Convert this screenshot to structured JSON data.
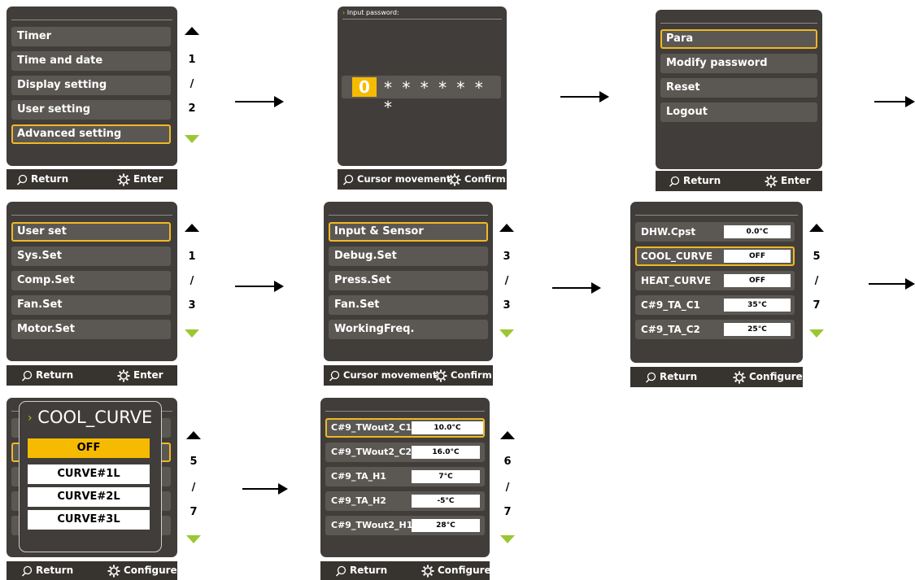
{
  "colors": {
    "screen_bg": "#403d3a",
    "item_bg": "#5b5854",
    "selected_border": "#f1b824",
    "selected_fill": "#f6bb00",
    "scroll_down": "#9bc733"
  },
  "s1": {
    "items": [
      "Timer",
      "Time and date",
      "Display setting",
      "User setting",
      "Advanced setting"
    ],
    "page": "1",
    "sep": "/",
    "total": "2",
    "footer_left": "Return",
    "footer_right": "Enter"
  },
  "s2": {
    "title": "Input password:",
    "digit": "0",
    "stars": "* * * * * * *",
    "footer_left": "Cursor movement",
    "footer_right": "Confirm"
  },
  "s3": {
    "items": [
      "Para",
      "Modify password",
      "Reset",
      "Logout"
    ],
    "footer_left": "Return",
    "footer_right": "Enter"
  },
  "s4": {
    "items": [
      "User set",
      "Sys.Set",
      "Comp.Set",
      "Fan.Set",
      "Motor.Set"
    ],
    "page": "1",
    "sep": "/",
    "total": "3",
    "footer_left": "Return",
    "footer_right": "Enter"
  },
  "s5": {
    "items": [
      "Input & Sensor",
      "Debug.Set",
      "Press.Set",
      "Fan.Set",
      "WorkingFreq."
    ],
    "page": "3",
    "sep": "/",
    "total": "3",
    "footer_left": "Cursor movement",
    "footer_right": "Confirm"
  },
  "s6": {
    "items": [
      {
        "label": "DHW.Cpst",
        "value": "0.0°C"
      },
      {
        "label": "COOL_CURVE",
        "value": "OFF"
      },
      {
        "label": "HEAT_CURVE",
        "value": "OFF"
      },
      {
        "label": "C#9_TA_C1",
        "value": "35°C"
      },
      {
        "label": "C#9_TA_C2",
        "value": "25°C"
      }
    ],
    "page": "5",
    "sep": "/",
    "total": "7",
    "footer_left": "Return",
    "footer_right": "Configure"
  },
  "s7": {
    "popup_title": "COOL_CURVE",
    "options": [
      "OFF",
      "CURVE#1L",
      "CURVE#2L",
      "CURVE#3L"
    ],
    "page": "5",
    "sep": "/",
    "total": "7",
    "footer_left": "Return",
    "footer_right": "Configure"
  },
  "s8": {
    "items": [
      {
        "label": "C#9_TWout2_C1",
        "value": "10.0°C"
      },
      {
        "label": "C#9_TWout2_C2",
        "value": "16.0°C"
      },
      {
        "label": "C#9_TA_H1",
        "value": "7°C"
      },
      {
        "label": "C#9_TA_H2",
        "value": "-5°C"
      },
      {
        "label": "C#9_TWout2_H1",
        "value": "28°C"
      }
    ],
    "page": "6",
    "sep": "/",
    "total": "7",
    "footer_left": "Return",
    "footer_right": "Configure"
  }
}
